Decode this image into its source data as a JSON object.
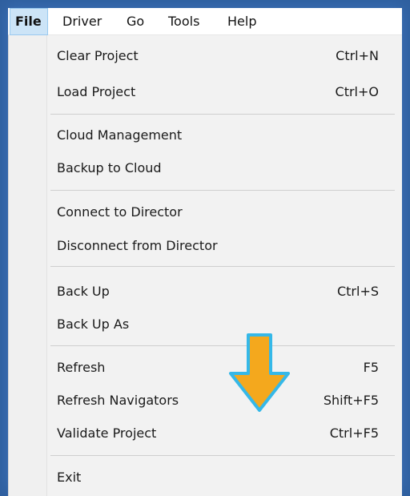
{
  "menubar": {
    "items": [
      {
        "label": "File"
      },
      {
        "label": "Driver"
      },
      {
        "label": "Go"
      },
      {
        "label": "Tools"
      },
      {
        "label": "Help"
      }
    ]
  },
  "file_menu": {
    "items": [
      {
        "label": "Clear Project",
        "shortcut": "Ctrl+N"
      },
      {
        "label": "Load Project",
        "shortcut": "Ctrl+O"
      },
      {
        "label": "Cloud Management",
        "shortcut": ""
      },
      {
        "label": "Backup to Cloud",
        "shortcut": ""
      },
      {
        "label": "Connect to Director",
        "shortcut": ""
      },
      {
        "label": "Disconnect from Director",
        "shortcut": ""
      },
      {
        "label": "Back Up",
        "shortcut": "Ctrl+S"
      },
      {
        "label": "Back Up As",
        "shortcut": ""
      },
      {
        "label": "Refresh",
        "shortcut": "F5"
      },
      {
        "label": "Refresh Navigators",
        "shortcut": "Shift+F5"
      },
      {
        "label": "Validate Project",
        "shortcut": "Ctrl+F5"
      },
      {
        "label": "Exit",
        "shortcut": ""
      }
    ]
  },
  "colors": {
    "frame": "#3a6fb5",
    "menu_background": "#f2f2f2",
    "active_menubar_item": "#cce4f7",
    "arrow_fill": "#f4a81d",
    "arrow_outline": "#35b8e8"
  },
  "icons": {
    "annotation": "arrow-down-icon"
  }
}
